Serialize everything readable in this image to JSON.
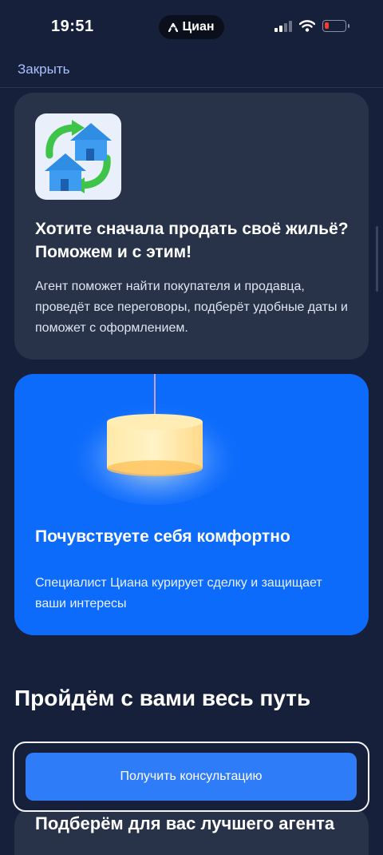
{
  "status_bar": {
    "time": "19:51",
    "island_label": "Циан",
    "battery_color": "#ff3b30"
  },
  "nav": {
    "close_label": "Закрыть"
  },
  "cards": [
    {
      "icon": "houses-exchange-icon",
      "title": "Хотите сначала продать своё жильё? Поможем и с этим!",
      "text": "Агент поможет найти покупателя и продавца, проведёт все переговоры, подберёт удобные даты и поможет с оформлением."
    },
    {
      "icon": "lamp-icon",
      "title": "Почувствуете себя комфортно",
      "text": "Специалист Циана курирует сделку и защищает ваши интересы"
    }
  ],
  "section_heading": "Пройдём с вами весь путь",
  "next_card_title": "Подберём для вас лучшего агента",
  "cta": {
    "label": "Получить консультацию"
  },
  "colors": {
    "background": "#17203a",
    "card_dark": "#283249",
    "card_blue": "#0d6bfb",
    "accent_button": "#2f7cf9",
    "link": "#a9c0ff"
  }
}
